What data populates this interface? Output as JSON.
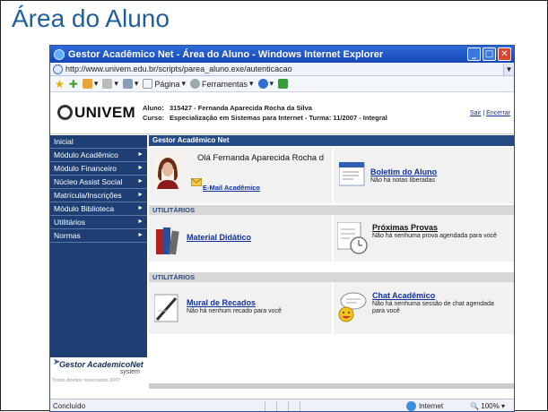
{
  "slide": {
    "title": "Área do Aluno"
  },
  "browser": {
    "window_title": "Gestor Acadêmico Net - Área do Aluno - Windows Internet Explorer",
    "url": "http://www.univem.edu.br/scripts/parea_aluno.exe/autenticacao",
    "cmd": {
      "page": "Página",
      "tools": "Ferramentas"
    },
    "status": "Concluído",
    "zone": "Internet",
    "zoom": "100%"
  },
  "header": {
    "logo": "UNIVEM",
    "aluno_label": "Aluno:",
    "aluno_value": "315427 - Fernanda Aparecida Rocha da Silva",
    "curso_label": "Curso:",
    "curso_value": "Especialização em Sistemas para Internet  - Turma: 11/2007 - Integral",
    "sair": "Sair",
    "sep": "|",
    "encerrar": "Encerrar"
  },
  "nav": {
    "items": [
      {
        "label": "Inicial",
        "arrow": ""
      },
      {
        "label": "Módulo Acadêmico",
        "arrow": "►"
      },
      {
        "label": "Módulo Financeiro",
        "arrow": "►"
      },
      {
        "label": "Núcleo Assist Social",
        "arrow": "►"
      },
      {
        "label": "Matrícula/Inscrições",
        "arrow": "►"
      },
      {
        "label": "Módulo Biblioteca",
        "arrow": "►"
      },
      {
        "label": "Utilitários",
        "arrow": "►"
      },
      {
        "label": "Normas",
        "arrow": "►"
      }
    ],
    "brand": "Gestor AcademicoNet",
    "brand_sub": "system",
    "copyright": "Todos direitos reservados 2007"
  },
  "main": {
    "section_title": "Gestor Acadêmico Net",
    "greeting": "Olá Fernanda Aparecida Rocha d",
    "email_link": "E-Mail Acadêmico",
    "boletim_title": "Boletim do Aluno",
    "boletim_desc": "Não há notas liberadas",
    "util1": "UTILITÁRIOS",
    "material_title": "Material Didático",
    "provas_title": "Próximas Provas",
    "provas_desc": "Não há nenhuma prova agendada para você",
    "util2": "UTILITÁRIOS",
    "mural_title": "Mural de Recados",
    "mural_desc": "Não há nenhum recado para você",
    "chat_title": "Chat Acadêmico",
    "chat_desc": "Não há nenhuma sessão de chat agendada para você"
  }
}
